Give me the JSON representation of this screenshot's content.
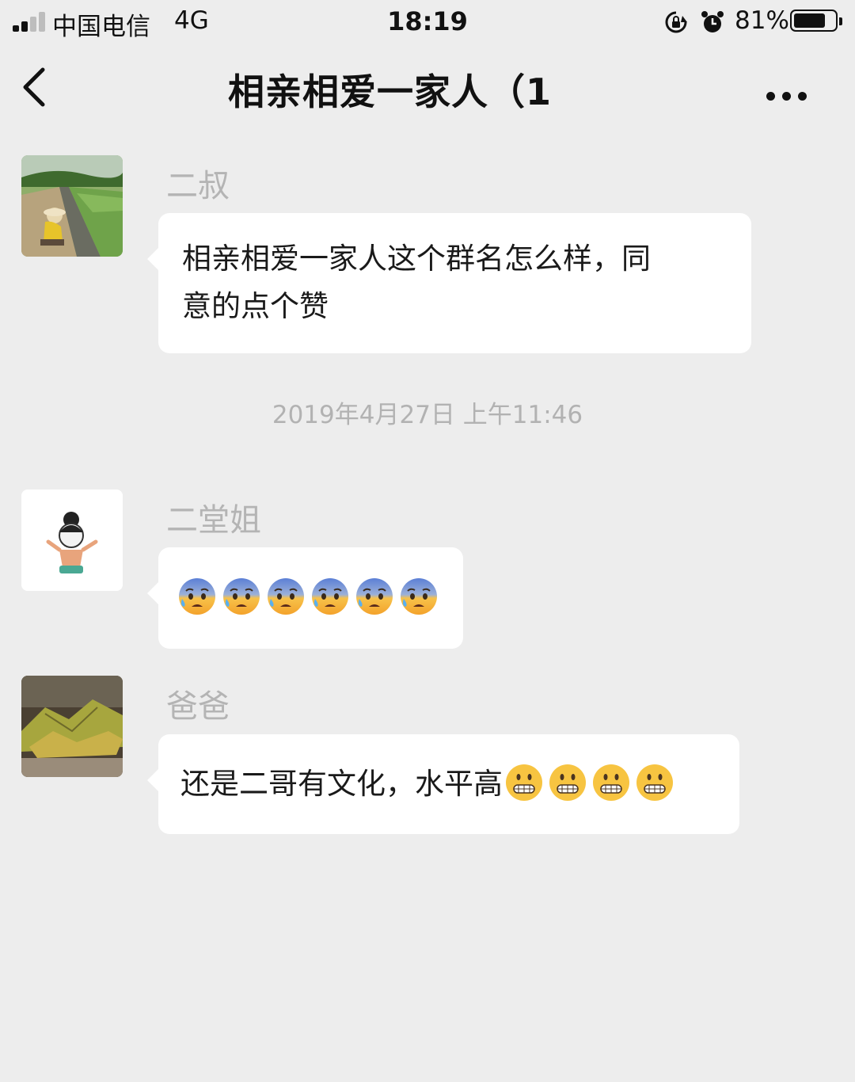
{
  "status_bar": {
    "carrier": "中国电信",
    "network": "4G",
    "time": "18:19",
    "battery_percent": "81%",
    "battery_level": 0.81,
    "icons": [
      "signal-icon",
      "rotation-lock-icon",
      "alarm-icon",
      "battery-icon"
    ]
  },
  "nav": {
    "title": "相亲相爱一家人（1",
    "back_icon": "chevron-left-icon",
    "more_icon": "more-dots-icon"
  },
  "messages": [
    {
      "sender": "二叔",
      "text_lines": [
        "相亲相爱一家人这个群名怎么样，同",
        "意的点个赞"
      ]
    },
    {
      "sender": "二堂姐",
      "emoji_name": "anxious-sweat-face-emoji",
      "emoji_count": 6
    },
    {
      "sender": "爸爸",
      "text": "还是二哥有文化，水平高",
      "emoji_name": "grimacing-face-emoji",
      "emoji_count": 4
    }
  ],
  "timestamp": "2019年4月27日 上午11:46",
  "colors": {
    "background": "#ededed",
    "bubble": "#ffffff",
    "sender_name": "#b4b4b4",
    "timestamp": "#b2b2b2"
  }
}
